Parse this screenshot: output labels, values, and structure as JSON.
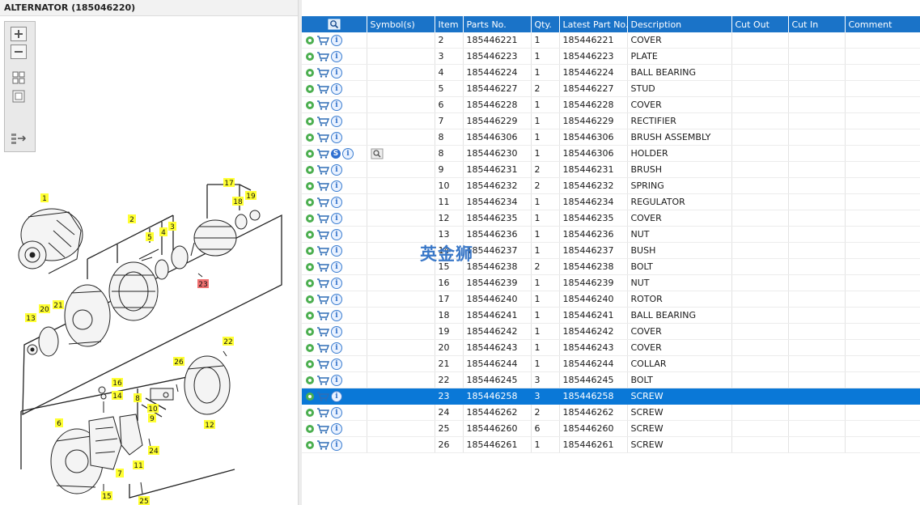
{
  "window": {
    "title": "ALTERNATOR (185046220)"
  },
  "toolbar": {
    "zoom_in": "+",
    "zoom_out": "−"
  },
  "watermark": "英金狮",
  "diagram": {
    "callouts": [
      "1",
      "2",
      "3",
      "4",
      "5",
      "6",
      "7",
      "8",
      "9",
      "10",
      "11",
      "12",
      "13",
      "14",
      "15",
      "16",
      "17",
      "18",
      "19",
      "20",
      "21",
      "22",
      "23",
      "24",
      "25",
      "26"
    ],
    "highlight_callout": "23",
    "highlight_color": "#f07070",
    "callout_color": "#ffff33"
  },
  "columns": {
    "symbols": "Symbol(s)",
    "item": "Item",
    "parts_no": "Parts No.",
    "qty": "Qty.",
    "latest": "Latest Part No.",
    "description": "Description",
    "cut_out": "Cut Out",
    "cut_in": "Cut In",
    "comment": "Comment"
  },
  "colors": {
    "header": "#1a73c8",
    "selected_row": "#0a78d7",
    "gear": "#4caf50",
    "cart": "#2f6db5"
  },
  "rows": [
    {
      "item": "2",
      "parts_no": "185446221",
      "qty": "1",
      "latest": "185446221",
      "description": "COVER"
    },
    {
      "item": "3",
      "parts_no": "185446223",
      "qty": "1",
      "latest": "185446223",
      "description": "PLATE"
    },
    {
      "item": "4",
      "parts_no": "185446224",
      "qty": "1",
      "latest": "185446224",
      "description": "BALL BEARING"
    },
    {
      "item": "5",
      "parts_no": "185446227",
      "qty": "2",
      "latest": "185446227",
      "description": "STUD"
    },
    {
      "item": "6",
      "parts_no": "185446228",
      "qty": "1",
      "latest": "185446228",
      "description": "COVER"
    },
    {
      "item": "7",
      "parts_no": "185446229",
      "qty": "1",
      "latest": "185446229",
      "description": "RECTIFIER"
    },
    {
      "item": "8",
      "parts_no": "185446306",
      "qty": "1",
      "latest": "185446306",
      "description": "BRUSH ASSEMBLY"
    },
    {
      "item": "8",
      "parts_no": "185446230",
      "qty": "1",
      "latest": "185446306",
      "description": "HOLDER",
      "s_badge": "S",
      "symbol_icon": "zoom-icon"
    },
    {
      "item": "9",
      "parts_no": "185446231",
      "qty": "2",
      "latest": "185446231",
      "description": "BRUSH"
    },
    {
      "item": "10",
      "parts_no": "185446232",
      "qty": "2",
      "latest": "185446232",
      "description": "SPRING"
    },
    {
      "item": "11",
      "parts_no": "185446234",
      "qty": "1",
      "latest": "185446234",
      "description": "REGULATOR"
    },
    {
      "item": "12",
      "parts_no": "185446235",
      "qty": "1",
      "latest": "185446235",
      "description": "COVER"
    },
    {
      "item": "13",
      "parts_no": "185446236",
      "qty": "1",
      "latest": "185446236",
      "description": "NUT"
    },
    {
      "item": "14",
      "parts_no": "185446237",
      "qty": "1",
      "latest": "185446237",
      "description": "BUSH"
    },
    {
      "item": "15",
      "parts_no": "185446238",
      "qty": "2",
      "latest": "185446238",
      "description": "BOLT"
    },
    {
      "item": "16",
      "parts_no": "185446239",
      "qty": "1",
      "latest": "185446239",
      "description": "NUT"
    },
    {
      "item": "17",
      "parts_no": "185446240",
      "qty": "1",
      "latest": "185446240",
      "description": "ROTOR"
    },
    {
      "item": "18",
      "parts_no": "185446241",
      "qty": "1",
      "latest": "185446241",
      "description": "BALL BEARING"
    },
    {
      "item": "19",
      "parts_no": "185446242",
      "qty": "1",
      "latest": "185446242",
      "description": "COVER"
    },
    {
      "item": "20",
      "parts_no": "185446243",
      "qty": "1",
      "latest": "185446243",
      "description": "COVER"
    },
    {
      "item": "21",
      "parts_no": "185446244",
      "qty": "1",
      "latest": "185446244",
      "description": "COLLAR"
    },
    {
      "item": "22",
      "parts_no": "185446245",
      "qty": "3",
      "latest": "185446245",
      "description": "BOLT"
    },
    {
      "item": "23",
      "parts_no": "185446258",
      "qty": "3",
      "latest": "185446258",
      "description": "SCREW",
      "selected": true
    },
    {
      "item": "24",
      "parts_no": "185446262",
      "qty": "2",
      "latest": "185446262",
      "description": "SCREW"
    },
    {
      "item": "25",
      "parts_no": "185446260",
      "qty": "6",
      "latest": "185446260",
      "description": "SCREW"
    },
    {
      "item": "26",
      "parts_no": "185446261",
      "qty": "1",
      "latest": "185446261",
      "description": "SCREW"
    }
  ]
}
